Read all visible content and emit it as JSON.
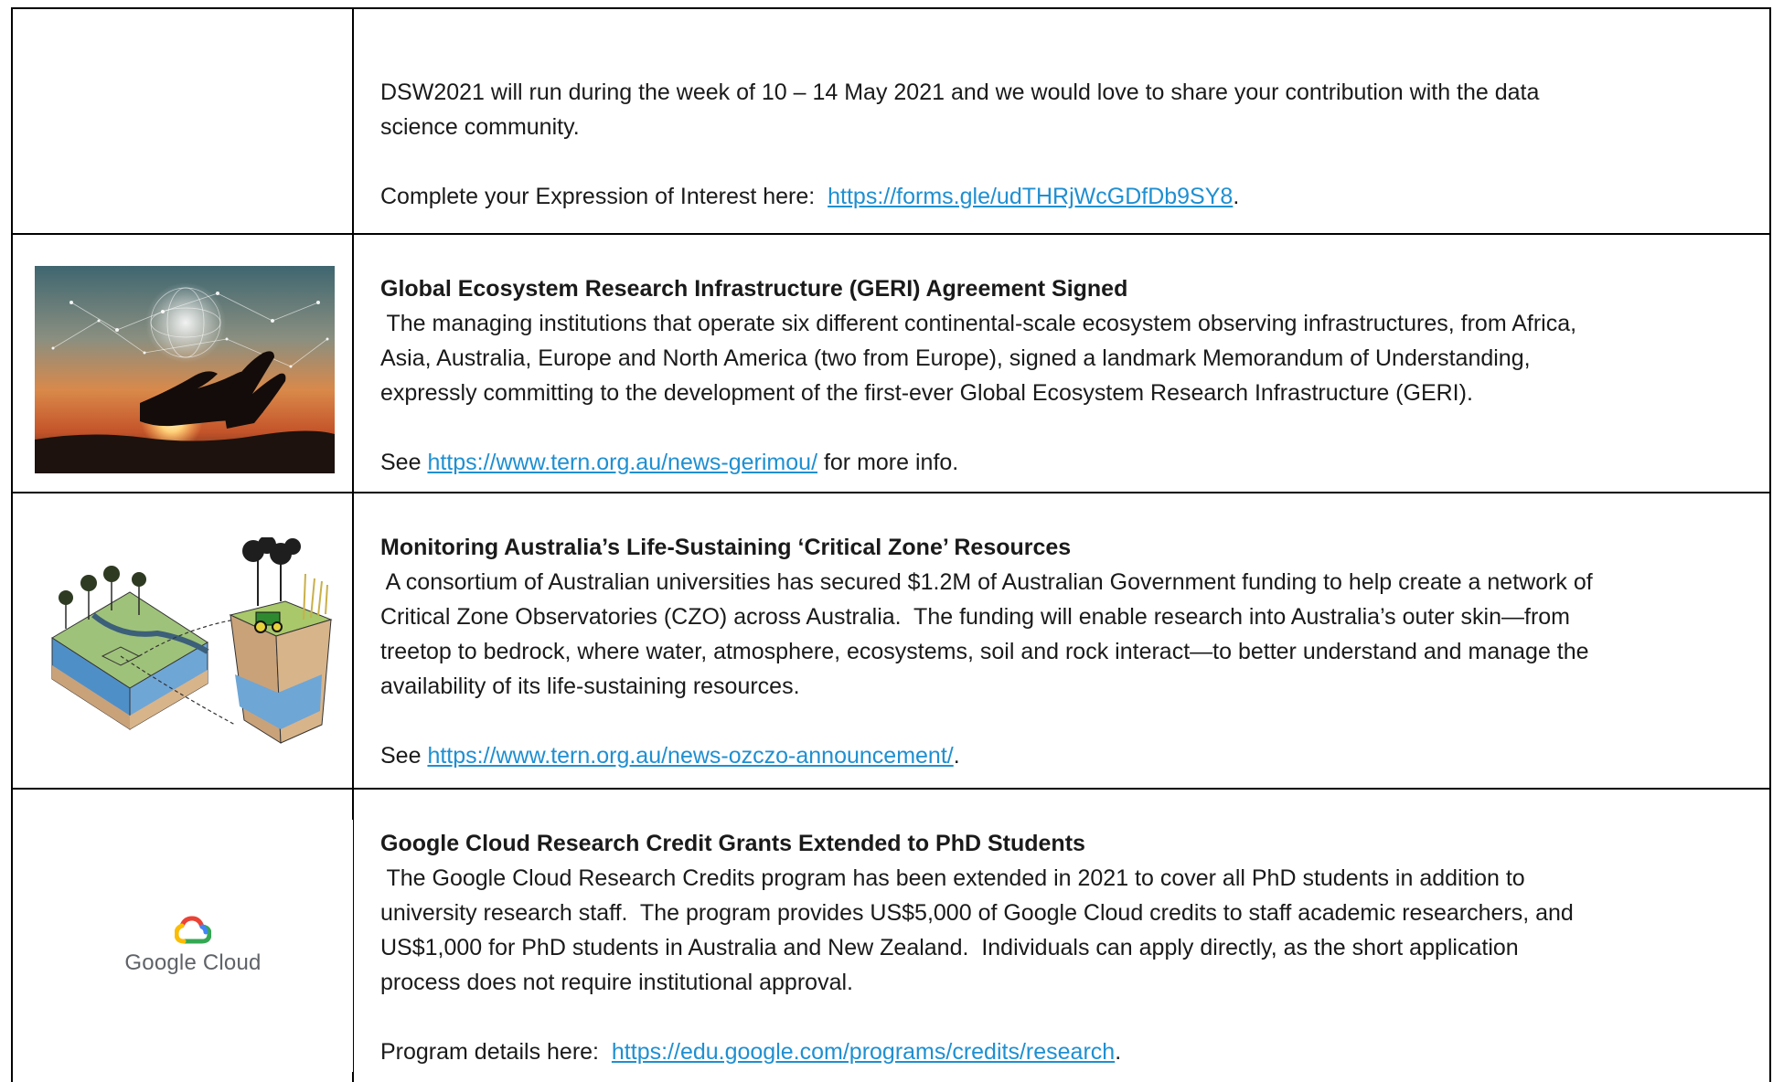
{
  "rows": [
    {
      "line1": "DSW2021 will run during the week of 10 – 14 May 2021 and we would love to share your contribution with the data",
      "line2": "science community.",
      "eoi_prefix": "Complete your Expression of Interest here:  ",
      "eoi_link": "https://forms.gle/udTHRjWcGDfDb9SY8",
      "eoi_suffix": "."
    },
    {
      "title": "Global Ecosystem Research Infrastructure (GERI) Agreement Signed",
      "body": [
        " The managing institutions that operate six different continental-scale ecosystem observing infrastructures, from Africa,",
        "Asia, Australia, Europe and North America (two from Europe), signed a landmark Memorandum of Understanding,",
        "expressly committing to the development of the first-ever Global Ecosystem Research Infrastructure (GERI)."
      ],
      "see_prefix": "See ",
      "see_link": "https://www.tern.org.au/news-gerimou/",
      "see_suffix": " for more info.",
      "image_icon": "hands-network-sunset-image"
    },
    {
      "title": "Monitoring Australia’s Life-Sustaining ‘Critical Zone’ Resources",
      "body": [
        " A consortium of Australian universities has secured $1.2M of Australian Government funding to help create a network of",
        "Critical Zone Observatories (CZO) across Australia.  The funding will enable research into Australia’s outer skin—from",
        "treetop to bedrock, where water, atmosphere, ecosystems, soil and rock interact—to better understand and manage the",
        "availability of its life-sustaining resources."
      ],
      "see_prefix": "See ",
      "see_link": "https://www.tern.org.au/news-ozczo-announcement/",
      "see_suffix": ".",
      "image_icon": "critical-zone-landscape-illustration"
    },
    {
      "title": "Google Cloud Research Credit Grants Extended to PhD Students",
      "body": [
        " The Google Cloud Research Credits program has been extended in 2021 to cover all PhD students in addition to",
        "university research staff.  The program provides US$5,000 of Google Cloud credits to staff academic researchers, and",
        "US$1,000 for PhD students in Australia and New Zealand.  Individuals can apply directly, as the short application",
        "process does not require institutional approval."
      ],
      "see_prefix": "Program details here:  ",
      "see_link": "https://edu.google.com/programs/credits/research",
      "see_suffix": ".",
      "logo_text": "Google Cloud",
      "image_icon": "google-cloud-logo"
    }
  ]
}
